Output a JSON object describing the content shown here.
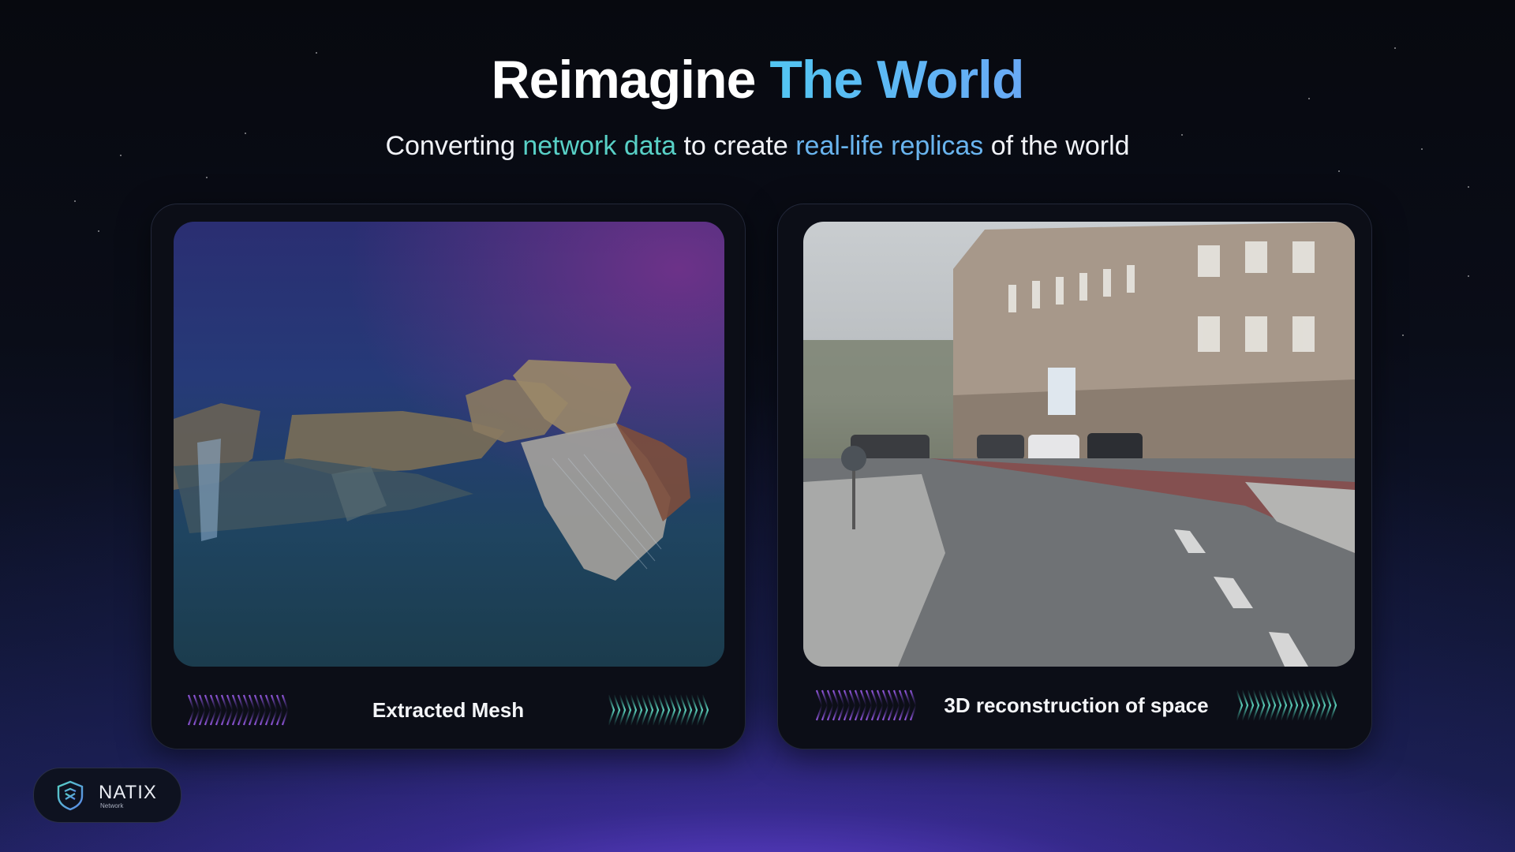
{
  "header": {
    "title_main": "Reimagine",
    "title_accent": "The World",
    "subtitle_part1": "Converting",
    "subtitle_highlight1": "network data",
    "subtitle_part2": "to create",
    "subtitle_highlight2": "real-life replicas",
    "subtitle_part3": "of the world"
  },
  "cards": [
    {
      "caption": "Extracted Mesh",
      "image": "3d-mesh-render"
    },
    {
      "caption": "3D reconstruction of space",
      "image": "street-reconstruction"
    }
  ],
  "logo": {
    "name": "NATIX",
    "sub": "Network",
    "icon": "shield-icon"
  },
  "colors": {
    "accent_teal": "#58d0c6",
    "accent_blue": "#69b4ee",
    "chevron_purple": "#8b4fd8",
    "chevron_teal": "#4fc7b0"
  }
}
